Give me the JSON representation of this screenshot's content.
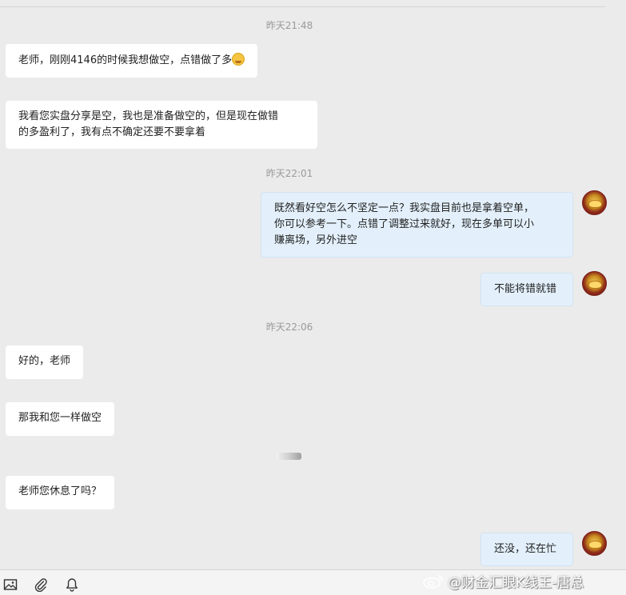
{
  "chat": {
    "timestamps": [
      "昨天21:48",
      "昨天22:01",
      "昨天22:06"
    ],
    "messages": [
      {
        "direction": "in",
        "text": "老师，刚刚4146的时候我想做空，点错做了多"
      },
      {
        "direction": "in",
        "text": "我看您实盘分享是空，我也是准备做空的，但是现在做错\n的多盈利了，我有点不确定还要不要拿着"
      },
      {
        "direction": "out",
        "text": "既然看好空怎么不坚定一点？我实盘目前也是拿着空单，\n你可以参考一下。点错了调整过来就好，现在多单可以小\n赚离场，另外进空"
      },
      {
        "direction": "out",
        "text": "不能将错就错"
      },
      {
        "direction": "in",
        "text": "好的，老师"
      },
      {
        "direction": "in",
        "text": "那我和您一样做空"
      },
      {
        "direction": "in",
        "text": "老师您休息了吗？"
      },
      {
        "direction": "out",
        "text": "还没，还在忙"
      }
    ],
    "emoji": "laughing-emoji"
  },
  "toolbar": {
    "icons": [
      "image-icon",
      "attachment-icon",
      "bell-icon"
    ]
  },
  "watermark": {
    "text": "@财金汇眼K线王-唐总"
  },
  "colors": {
    "background": "#ebebeb",
    "incoming_bubble": "#ffffff",
    "outgoing_bubble": "#e3f0fb",
    "timestamp": "#9a9a9a"
  }
}
